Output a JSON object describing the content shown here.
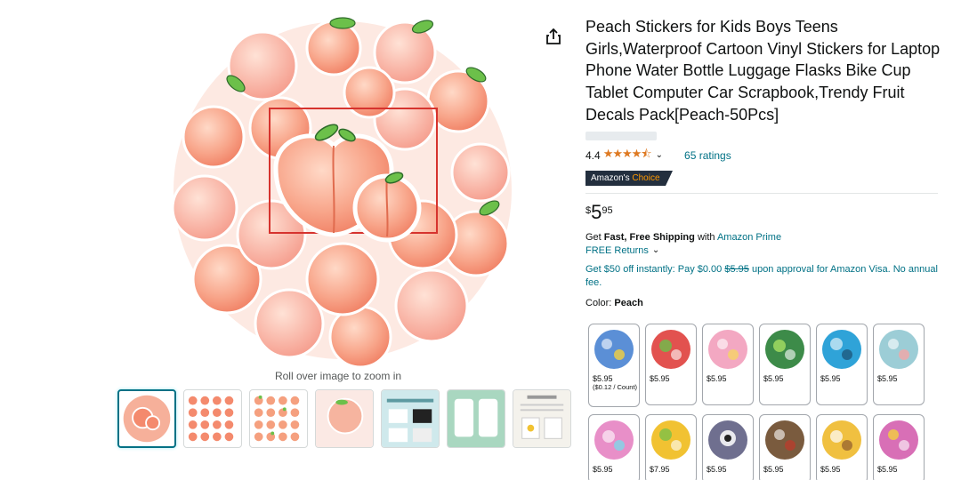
{
  "gallery": {
    "zoom_hint": "Roll over image to zoom in",
    "share_icon": "share-icon",
    "thumbnails": [
      {
        "name": "thumb-main"
      },
      {
        "name": "thumb-grid-peaches"
      },
      {
        "name": "thumb-grid-peaches-2"
      },
      {
        "name": "thumb-peach-closeup"
      },
      {
        "name": "thumb-applications"
      },
      {
        "name": "thumb-luggage"
      },
      {
        "name": "thumb-reusable"
      }
    ]
  },
  "product": {
    "title": "Peach Stickers for Kids Boys Teens Girls,Waterproof Cartoon Vinyl Stickers for Laptop Phone Water Bottle Luggage Flasks Bike Cup Tablet Computer Car Scrapbook,Trendy Fruit Decals Pack[Peach-50Pcs]",
    "rating": "4.4",
    "stars": "★★★★⯪",
    "rating_count": "65 ratings",
    "badge_prefix": "Amazon's",
    "badge_choice": "Choice",
    "price_symbol": "$",
    "price_whole": "5",
    "price_fraction": "95",
    "shipping_prefix": "Get",
    "shipping_bold": "Fast, Free Shipping",
    "shipping_with": "with",
    "shipping_link": "Amazon Prime",
    "returns": "FREE Returns",
    "promo_before": "Get $50 off instantly: Pay $0.00",
    "promo_strike": "$5.95",
    "promo_after": "upon approval for Amazon Visa. No annual fee.",
    "color_label": "Color:",
    "color_value": "Peach"
  },
  "swatches": [
    {
      "price": "$5.95",
      "unit": "($0.12 / Count)",
      "color": "#5b8fd6"
    },
    {
      "price": "$5.95",
      "unit": "",
      "color": "#e2524f"
    },
    {
      "price": "$5.95",
      "unit": "",
      "color": "#f3a8c2"
    },
    {
      "price": "$5.95",
      "unit": "",
      "color": "#3d8b49"
    },
    {
      "price": "$5.95",
      "unit": "",
      "color": "#2fa3d8"
    },
    {
      "price": "$5.95",
      "unit": "",
      "color": "#9ccdd6"
    },
    {
      "price": "$5.95",
      "unit": "",
      "color": "#e88fc8"
    },
    {
      "price": "$7.95",
      "unit": "",
      "color": "#f1c232"
    },
    {
      "price": "$5.95",
      "unit": "",
      "color": "#6f6f8f"
    },
    {
      "price": "$5.95",
      "unit": "",
      "color": "#7a5b3e"
    },
    {
      "price": "$5.95",
      "unit": "",
      "color": "#f0c040"
    },
    {
      "price": "$5.95",
      "unit": "",
      "color": "#d86fb6"
    }
  ]
}
